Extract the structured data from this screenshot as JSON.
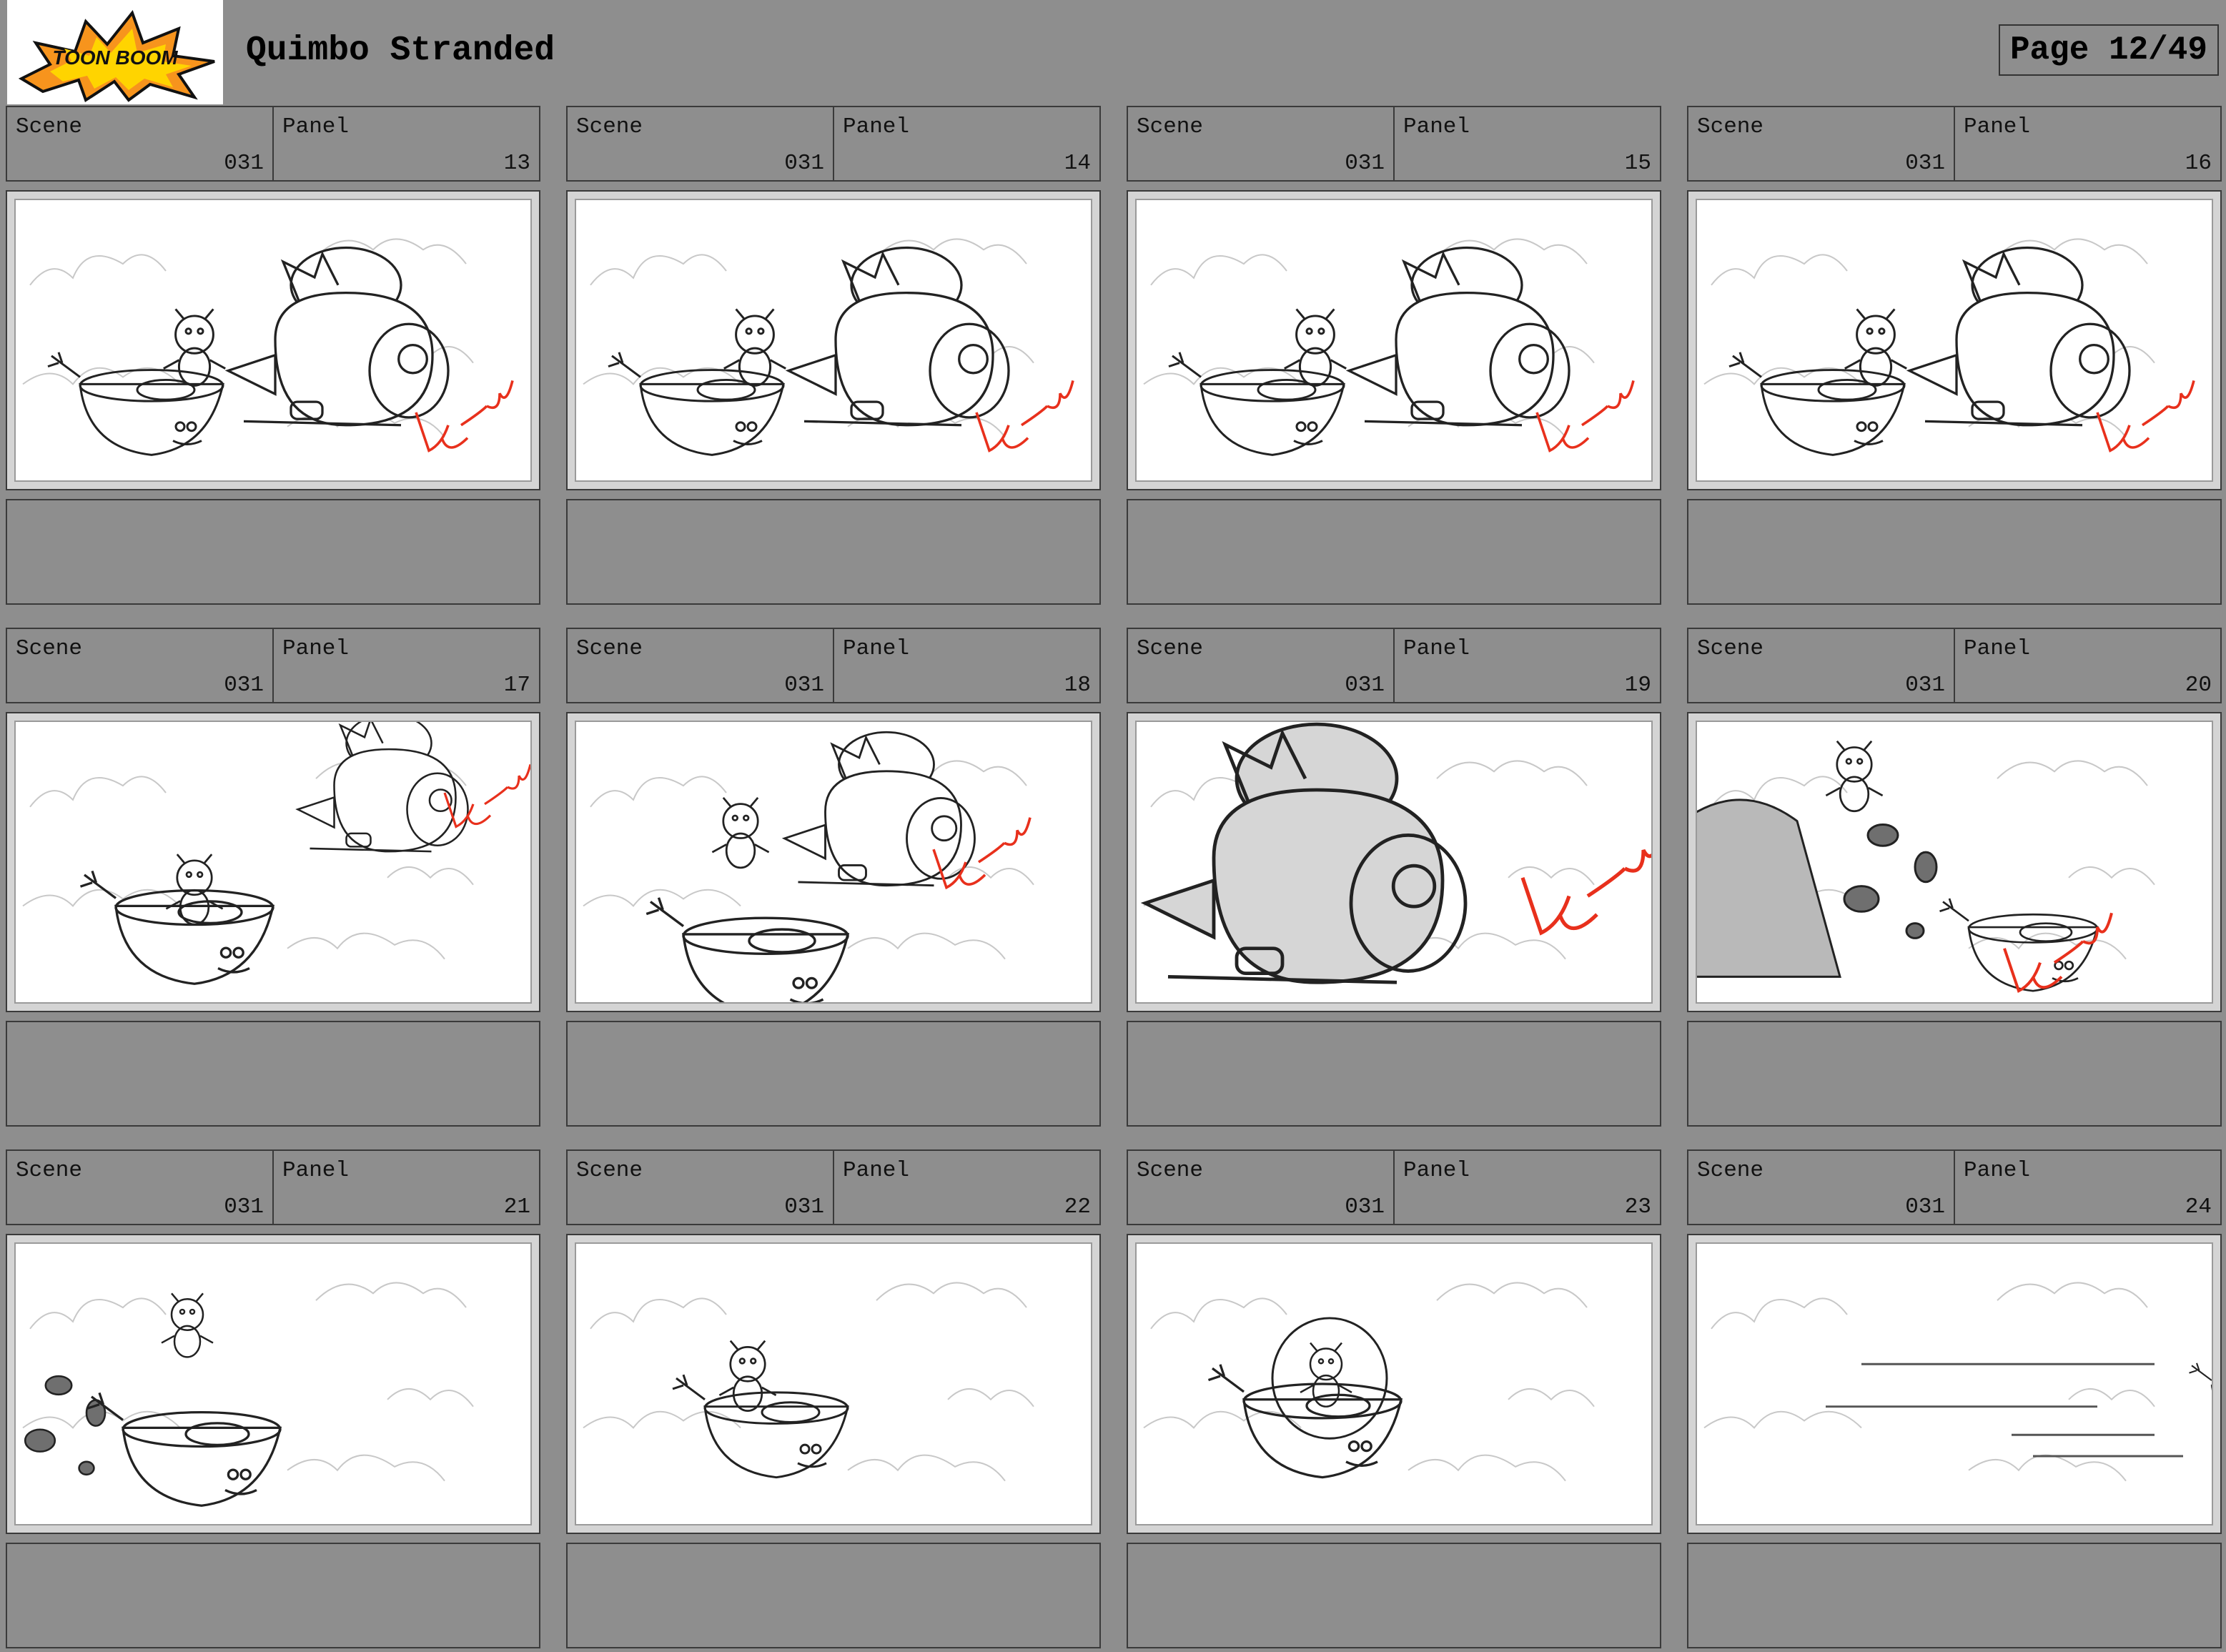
{
  "app": {
    "logo_text": "TOON BOOM",
    "title": "Quimbo Stranded",
    "page_label": "Page 12/49"
  },
  "panel_labels": {
    "scene": "Scene",
    "panel": "Panel"
  },
  "panels": [
    {
      "scene": "031",
      "panel": "13",
      "sketch": "apple-and-ship"
    },
    {
      "scene": "031",
      "panel": "14",
      "sketch": "apple-and-ship"
    },
    {
      "scene": "031",
      "panel": "15",
      "sketch": "apple-and-ship"
    },
    {
      "scene": "031",
      "panel": "16",
      "sketch": "apple-and-ship"
    },
    {
      "scene": "031",
      "panel": "17",
      "sketch": "ship-flying-away"
    },
    {
      "scene": "031",
      "panel": "18",
      "sketch": "ship-over-apple"
    },
    {
      "scene": "031",
      "panel": "19",
      "sketch": "ship-closeup"
    },
    {
      "scene": "031",
      "panel": "20",
      "sketch": "debris-closeup"
    },
    {
      "scene": "031",
      "panel": "21",
      "sketch": "apple-with-debris"
    },
    {
      "scene": "031",
      "panel": "22",
      "sketch": "apple-alone"
    },
    {
      "scene": "031",
      "panel": "23",
      "sketch": "apple-with-bubble"
    },
    {
      "scene": "031",
      "panel": "24",
      "sketch": "speed-lines"
    }
  ],
  "colors": {
    "background": "#8e8e8e",
    "sketch_line": "#222222",
    "sketch_cloud": "#c8c8c8",
    "sketch_red": "#e8301c",
    "logo_orange": "#f7941d"
  }
}
